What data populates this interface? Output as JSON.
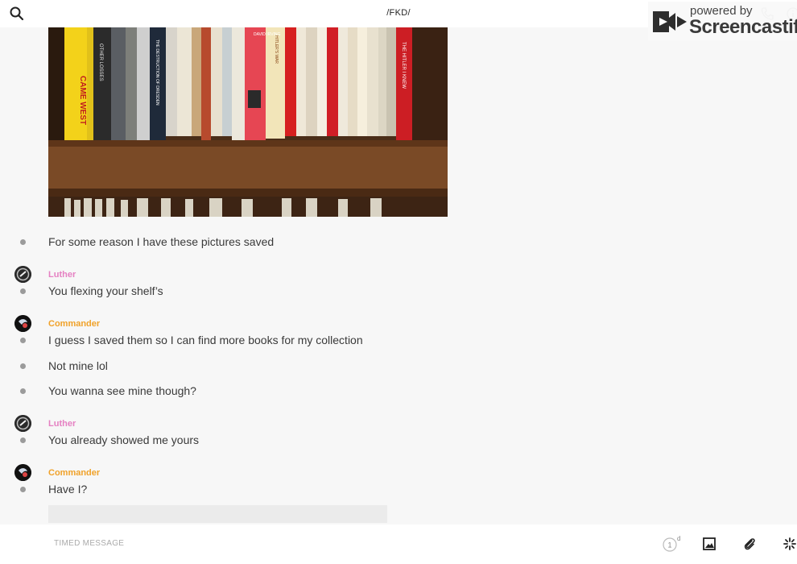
{
  "header": {
    "title": "/FKD/"
  },
  "watermark": {
    "line1": "powered by",
    "line2": "Screencastify"
  },
  "messages": [
    {
      "text": "For some reason I have these pictures saved"
    },
    {
      "sender": "Luther",
      "text": "You flexing your shelf’s"
    },
    {
      "sender": "Commander",
      "text": "I guess I saved them so I can find more books for my collection"
    },
    {
      "text": "Not mine lol"
    },
    {
      "text": "You wanna see mine though?"
    },
    {
      "sender": "Luther",
      "text": "You already showed me yours"
    },
    {
      "sender": "Commander",
      "text": "Have I?"
    }
  ],
  "colors": {
    "luther": "#e580c2",
    "commander": "#f0a22a",
    "dot": "#9b9b9b"
  },
  "composer": {
    "placeholder": "TIMED MESSAGE",
    "timer_value": "1",
    "timer_unit": "d"
  },
  "photo": {
    "spines": [
      {
        "text": "CAME WEST"
      },
      {
        "text": "OTHER LOSSES"
      },
      {
        "text": "THE DESTRUCTION OF DRESDEN"
      },
      {
        "text": "DAVID IRVING"
      },
      {
        "text": "HITLER'S WAR"
      },
      {
        "text": "THE HITLER I KNEW"
      }
    ]
  }
}
